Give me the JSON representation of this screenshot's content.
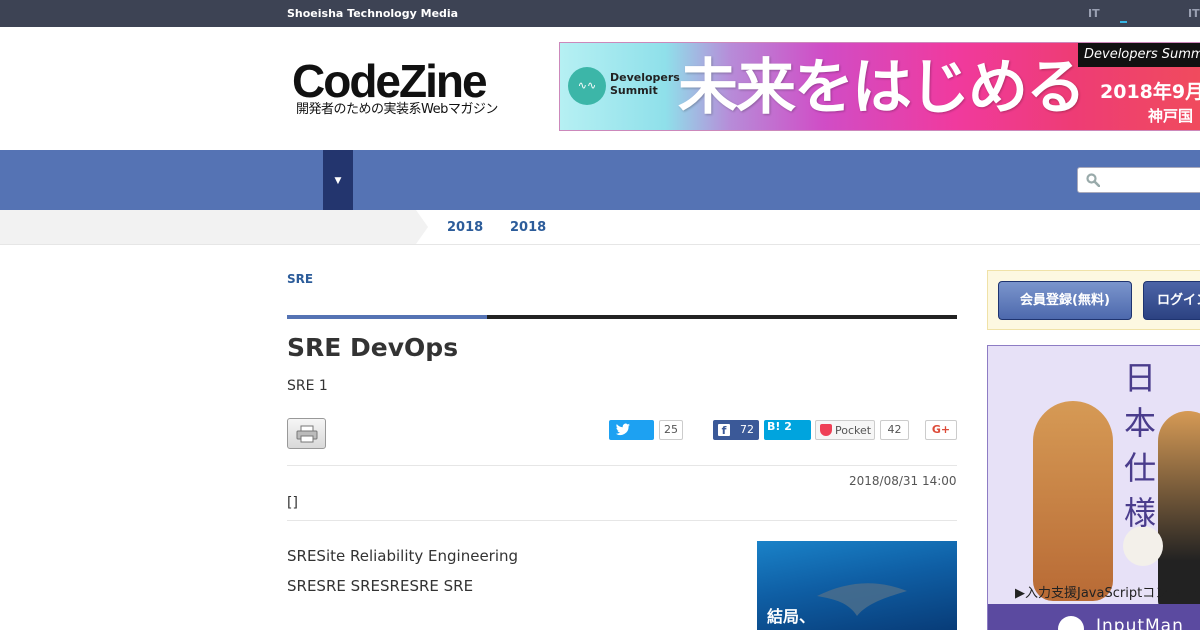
{
  "topbar": {
    "brand": "Shoeisha Technology Media",
    "link_it_1": "IT",
    "link_it_2": "IT"
  },
  "logo": {
    "name": "CodeZine",
    "tagline": "開発者のための実装系Webマガジン"
  },
  "banner": {
    "badge_line1": "Developers",
    "badge_line2": "Summit",
    "headline": "未来をはじめる",
    "date": "2018年9月",
    "place": "神戸国",
    "event_tag": "Developers Summit"
  },
  "nav": {
    "dropdown_arrow": "▼",
    "search_placeholder": ""
  },
  "breadcrumb": {
    "items": [
      "2018",
      "2018"
    ]
  },
  "article": {
    "category": "SRE",
    "title": "SRE DevOps",
    "subtitle": "SRE 1",
    "date": "2018/08/31 14:00",
    "author": "[]",
    "paragraphs": [
      "SRESite Reliability Engineering",
      "SRESRE SRESRESRE SRE"
    ]
  },
  "share": {
    "twitter_count": "25",
    "facebook_count": "72",
    "hatena_label": "B! 2",
    "pocket_label": "Pocket",
    "pocket_count": "42",
    "gplus_label": "G+"
  },
  "inline_ad": {
    "text": "結局、"
  },
  "sidebar": {
    "register_label": "会員登録(無料)",
    "login_label": "ログイン",
    "ad_vertical_text": "日本仕様",
    "ad_caption": "▶入力支援JavaScriptコントロー",
    "ad_footer": "InputMan"
  },
  "colors": {
    "nav_blue": "#5573b4",
    "topbar": "#3d4354",
    "link_blue": "#2c5c9a"
  }
}
